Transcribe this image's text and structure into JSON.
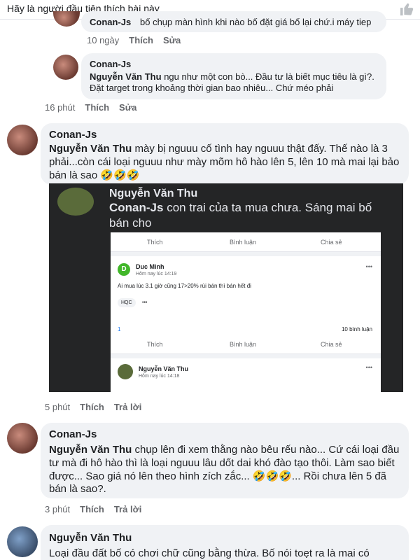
{
  "header": {
    "prompt": "Hãy là người đầu tiên thích bài này"
  },
  "thread": [
    {
      "id": "c1",
      "author": "Conan-Js",
      "text_partial": "bố chụp màn hình khi nào bố đặt giá bố lại chứ.i máy tiep",
      "time": "10 ngày",
      "actions": [
        "Thích",
        "Sửa"
      ]
    },
    {
      "id": "c2",
      "author": "Conan-Js",
      "mention": "Nguyễn Văn Thu",
      "text": "ngu như một con bò... Đầu tư là biết mục tiêu là gì?. Đặt target trong khoảng thời gian bao nhiêu... Chứ méo phải",
      "time": "16 phút",
      "actions": [
        "Thích",
        "Sửa"
      ]
    },
    {
      "id": "c3",
      "author": "Conan-Js",
      "mention": "Nguyễn Văn Thu",
      "text": "mày bị nguuu cố tình hay nguuu thật đấy. Thế nào là 3 phải...còn cái loại nguuu như mày mõm hô hào lên 5, lên 10 mà mai lại bảo bán là sao 🤣🤣🤣",
      "time": "5 phút",
      "actions": [
        "Thích",
        "Trả lời"
      ],
      "screenshot": {
        "top_name": "Nguyễn Văn Thu",
        "mention": "Conan-Js",
        "text": "con trai của ta mua chưa. Sáng mai bố bán cho",
        "bar": [
          "Thích",
          "Bình luận",
          "Chia sẻ"
        ],
        "post_author": "Duc Minh",
        "post_initial": "D",
        "post_time": "Hôm nay lúc 14:19",
        "post_text": "Ai mua lúc 3.1 giờ cũng 17>20% rùi bán thì bán hết đi",
        "post_tag": "HQC",
        "likes": "1",
        "comments": "10 bình luận",
        "post2_author": "Nguyễn Văn Thu",
        "post2_time": "Hôm nay lúc 14:18"
      }
    },
    {
      "id": "c4",
      "author": "Conan-Js",
      "mention": "Nguyễn Văn Thu",
      "text": "chụp lên đi xem thằng nào bêu rếu nào... Cứ cái loại đầu tư mà đi hô hào thì là loại nguuu lâu dốt dai khó đào tạo thôi. Làm sao biết được... Sao giá nó lên theo hình zích zắc... 🤣🤣🤣... Rồi chưa lên 5 đã bán là sao?.",
      "time": "3 phút",
      "actions": [
        "Thích",
        "Trả lời"
      ]
    },
    {
      "id": "c5",
      "author": "Nguyễn Văn Thu",
      "text": "Loại đầu đất bố có chơi chữ cũng bằng thừa. Bố nói toẹt ra là mai có"
    }
  ]
}
